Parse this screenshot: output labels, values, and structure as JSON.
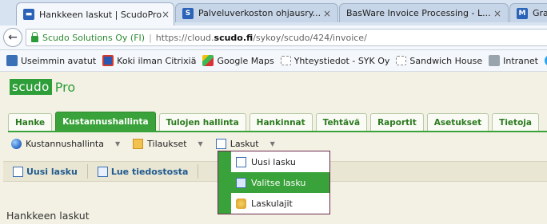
{
  "browser": {
    "tabs": [
      {
        "title": "Hankkeen laskut | ScudoPro",
        "active": true,
        "favicon": "scudo-icon",
        "close": "×"
      },
      {
        "title": "Palveluverkoston ohjausry...",
        "active": false,
        "favicon": "s-icon",
        "close": "×"
      },
      {
        "title": "BasWare Invoice Processing - L...",
        "active": false,
        "favicon": "",
        "close": "×"
      },
      {
        "title": "Gran",
        "active": false,
        "favicon": "m-icon"
      }
    ],
    "back_glyph": "←",
    "site_label": "Scudo Solutions Oy (FI)",
    "separator": "|",
    "url_prefix": "https://cloud.",
    "url_host": "scudo.fi",
    "url_path": "/sykoy/scudo/424/invoice/",
    "bookmarks": [
      {
        "label": "Useimmin avatut",
        "icon": "most-visited-icon"
      },
      {
        "label": "Koki ilman Citrixiä",
        "icon": "bookmark-icon"
      },
      {
        "label": "Google Maps",
        "icon": "maps-icon"
      },
      {
        "label": "Yhteystiedot - SYK Oy",
        "icon": "folder-icon"
      },
      {
        "label": "Sandwich House",
        "icon": "folder-icon"
      },
      {
        "label": "Intranet",
        "icon": "intranet-icon"
      },
      {
        "label": "Tw",
        "icon": "twitter-icon"
      }
    ]
  },
  "app": {
    "logo_box": "scudo",
    "logo_pro": "Pro",
    "nav_tabs": [
      {
        "label": "Hanke",
        "active": false
      },
      {
        "label": "Kustannushallinta",
        "active": true
      },
      {
        "label": "Tulojen hallinta",
        "active": false
      },
      {
        "label": "Hankinnat",
        "active": false
      },
      {
        "label": "Tehtävä",
        "active": false
      },
      {
        "label": "Raportit",
        "active": false
      },
      {
        "label": "Asetukset",
        "active": false
      },
      {
        "label": "Tietoja",
        "active": false
      }
    ],
    "sub_nav": [
      {
        "label": "Kustannushallinta",
        "icon": "globe-icon"
      },
      {
        "label": "Tilaukset",
        "icon": "folder-icon"
      },
      {
        "label": "Laskut",
        "icon": "document-icon"
      }
    ],
    "caret": "▼",
    "actions": {
      "new_invoice": "Uusi lasku",
      "read_file": "Lue tiedostosta"
    },
    "heading": "Hankkeen laskut",
    "dropdown": [
      {
        "label": "Uusi lasku",
        "icon": "new-invoice-icon",
        "hover": false
      },
      {
        "label": "Valitse lasku",
        "icon": "select-invoice-icon",
        "hover": true
      },
      {
        "label": "Laskulajit",
        "icon": "invoice-types-icon",
        "hover": false
      }
    ]
  },
  "colors": {
    "accent_green": "#3aa23a",
    "link_blue": "#1f5a8f",
    "dropdown_border": "#6c2a4c"
  }
}
